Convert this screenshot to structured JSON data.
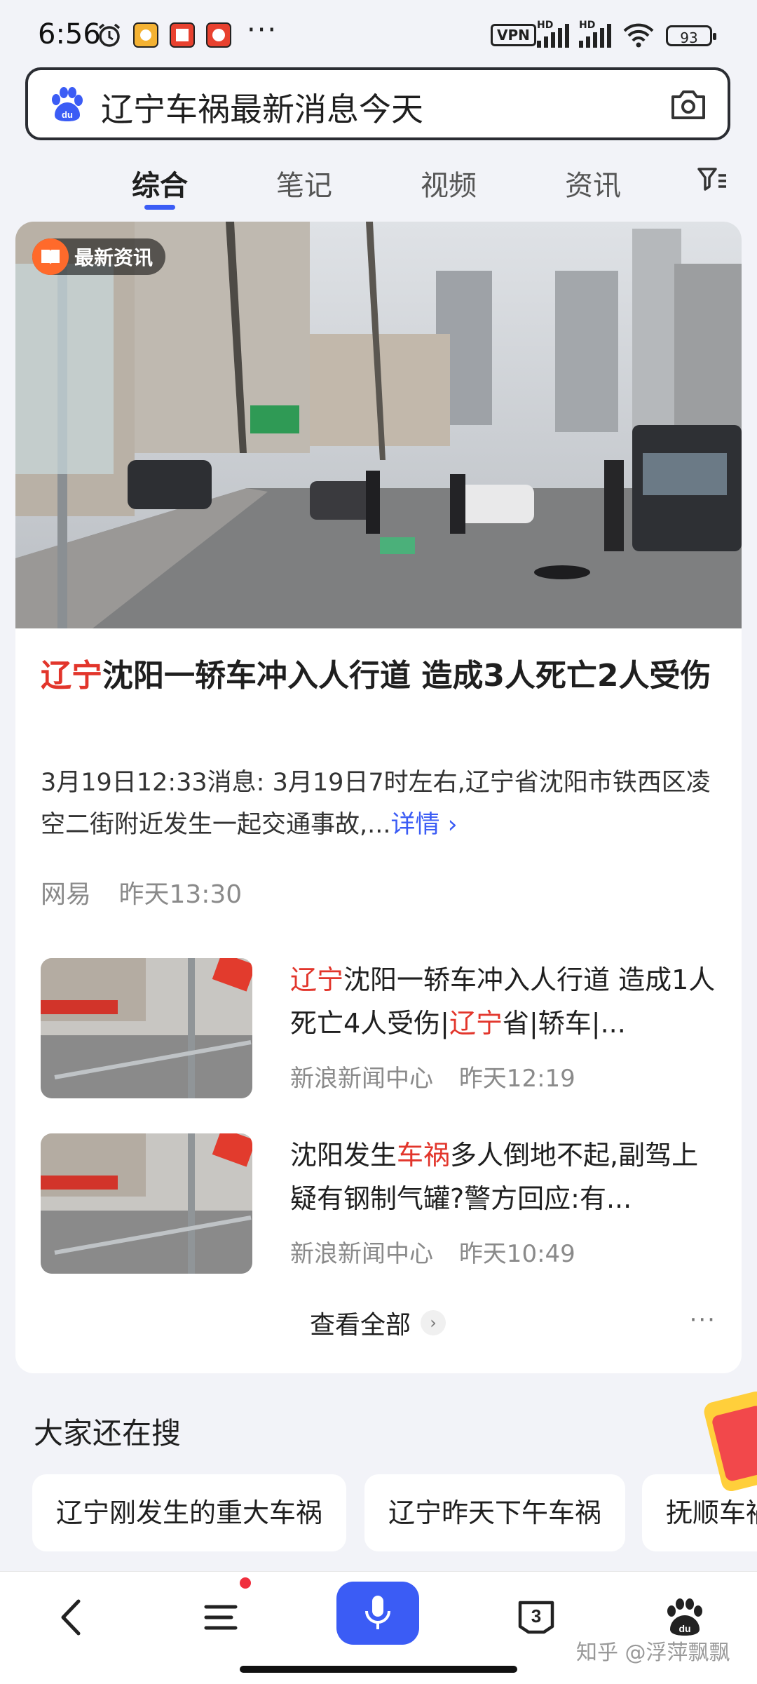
{
  "status_bar": {
    "time": "6:56",
    "more": "···",
    "vpn": "VPN",
    "hd1": "HD",
    "hd2": "HD",
    "battery": "93"
  },
  "search": {
    "query": "辽宁车祸最新消息今天"
  },
  "tabs": [
    {
      "label": "综合",
      "active": true
    },
    {
      "label": "笔记",
      "active": false
    },
    {
      "label": "视频",
      "active": false
    },
    {
      "label": "资讯",
      "active": false
    }
  ],
  "main_card": {
    "badge": "最新资讯",
    "headline_highlight": "辽宁",
    "headline_rest": "沈阳一轿车冲入人行道 造成3人死亡2人受伤",
    "summary": "3月19日12:33消息: 3月19日7时左右,辽宁省沈阳市铁西区凌空二街附近发生一起交通事故,...",
    "more_link": "详情 ›",
    "source": "网易",
    "time": "昨天13:30"
  },
  "news_items": [
    {
      "title_hl": "辽宁",
      "title_mid": "沈阳一轿车冲入人行道 造成1人死亡4人受伤|",
      "title_hl2": "辽宁",
      "title_end": "省|轿车|...",
      "source": "新浪新闻中心",
      "time": "昨天12:19"
    },
    {
      "title_pre": "沈阳发生",
      "title_hl": "车祸",
      "title_end": "多人倒地不起,副驾上疑有钢制气罐?警方回应:有...",
      "source": "新浪新闻中心",
      "time": "昨天10:49"
    }
  ],
  "view_all": "查看全部",
  "card_more": "···",
  "related": {
    "title": "大家还在搜",
    "chips": [
      "辽宁刚发生的重大车祸",
      "辽宁昨天下午车祸",
      "抚顺车祸"
    ]
  },
  "bottom_nav": {
    "tab_badge_count": "3",
    "watermark": "知乎 @浮萍飘飘"
  },
  "colors": {
    "accent": "#3b5cf5",
    "highlight": "#e2352b",
    "background": "#f2f3f8"
  }
}
